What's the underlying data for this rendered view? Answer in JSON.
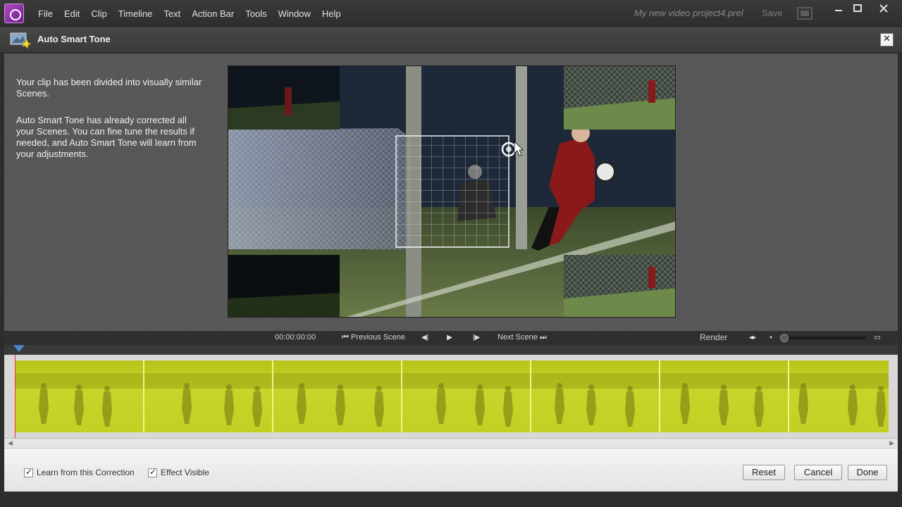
{
  "menubar": {
    "items": [
      "File",
      "Edit",
      "Clip",
      "Timeline",
      "Text",
      "Action Bar",
      "Tools",
      "Window",
      "Help"
    ],
    "project_name": "My new video project4.prel",
    "save_label": "Save",
    "window_controls": [
      "minimize-icon",
      "maximize-icon",
      "close-icon"
    ]
  },
  "dialog": {
    "title": "Auto Smart Tone",
    "close_glyph": "✕"
  },
  "intro": {
    "paragraph1": "Your clip has been divided into visually similar Scenes.",
    "paragraph2": "Auto Smart Tone has already corrected all your Scenes. You can fine tune the results if needed, and Auto Smart Tone will learn from your adjustments."
  },
  "transport": {
    "timecode": "00:00:00:00",
    "previous_scene": "Previous Scene",
    "next_scene": "Next Scene",
    "render_label": "Render",
    "icons": [
      "previous-scene-icon",
      "step-back-icon",
      "play-icon",
      "step-forward-icon",
      "next-scene-icon",
      "fit-icon",
      "small-thumb-icon",
      "large-thumb-icon"
    ]
  },
  "timeline": {
    "scene_count": 7,
    "highlight_color": "#c6d12a"
  },
  "bottom": {
    "learn_label": "Learn from this Correction",
    "learn_checked": true,
    "effect_label": "Effect Visible",
    "effect_checked": true,
    "reset_label": "Reset",
    "cancel_label": "Cancel",
    "done_label": "Done"
  },
  "colors": {
    "accent": "#8e2fa8",
    "background": "#2d2d2d",
    "panel": "#5b5b5b"
  }
}
